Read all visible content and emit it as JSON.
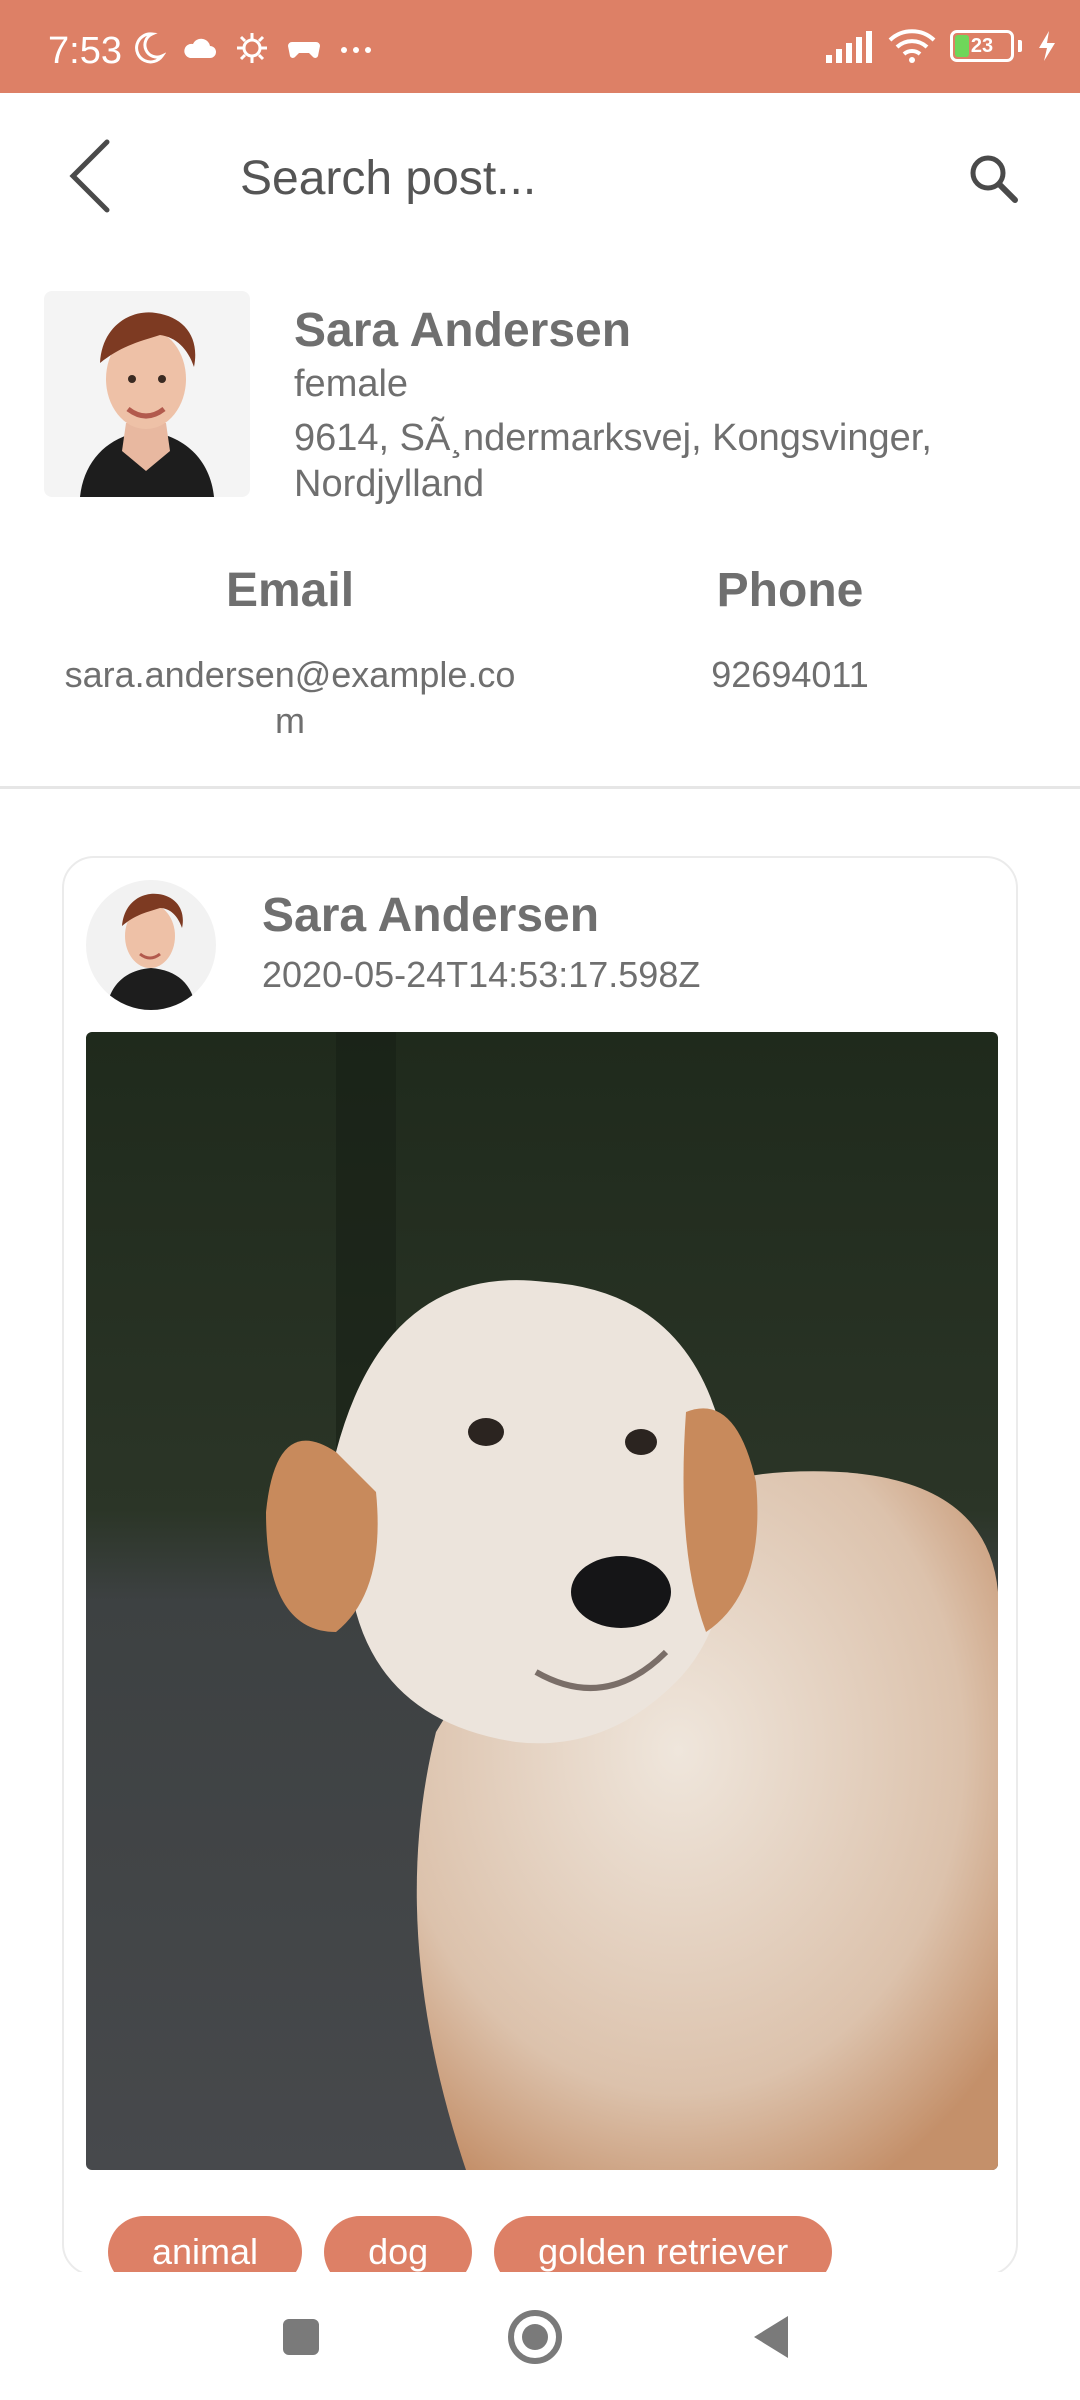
{
  "status_bar": {
    "time": "7:53",
    "battery_level": "23",
    "icons": [
      "moon-icon",
      "cloud-icon",
      "gear-icon",
      "gamepad-icon",
      "more-icon",
      "signal-icon",
      "wifi-icon",
      "battery-icon",
      "charging-icon"
    ]
  },
  "app_bar": {
    "search_placeholder": "Search post..."
  },
  "profile": {
    "name": "Sara Andersen",
    "gender": "female",
    "address": "9614, SÃ¸ndermarksvej, Kongsvinger, Nordjylland",
    "email_label": "Email",
    "email": "sara.andersen@example.com",
    "phone_label": "Phone",
    "phone": "92694011"
  },
  "post": {
    "author": "Sara Andersen",
    "date": "2020-05-24T14:53:17.598Z",
    "tags": [
      "animal",
      "dog",
      "golden retriever"
    ]
  },
  "colors": {
    "accent": "#dd8066",
    "text": "#6f6f6f"
  }
}
